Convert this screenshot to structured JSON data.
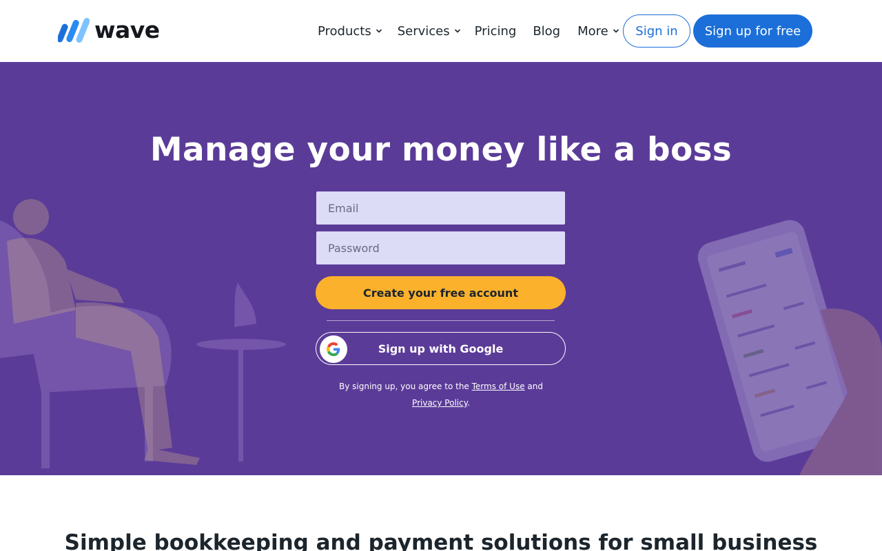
{
  "brand": {
    "name": "wave",
    "colors": {
      "primary_blue": "#1c6fd8",
      "hero_purple": "#5b3b98",
      "cta_yellow": "#fbb12c",
      "input_bg": "#dcdcf7"
    }
  },
  "header": {
    "nav": [
      {
        "label": "Products",
        "has_dropdown": true
      },
      {
        "label": "Services",
        "has_dropdown": true
      },
      {
        "label": "Pricing",
        "has_dropdown": false
      },
      {
        "label": "Blog",
        "has_dropdown": false
      },
      {
        "label": "More",
        "has_dropdown": true
      }
    ],
    "signin_label": "Sign in",
    "signup_label": "Sign up for free"
  },
  "hero": {
    "title": "Manage your money like a boss",
    "email_placeholder": "Email",
    "password_placeholder": "Password",
    "create_label": "Create your free account",
    "google_label": "Sign up with Google",
    "legal_prefix": "By signing up, you agree to the",
    "terms_label": "Terms of Use",
    "legal_and": "and",
    "privacy_label": "Privacy Policy",
    "legal_suffix": "."
  },
  "section": {
    "title": "Simple bookkeeping and payment solutions for small business"
  },
  "icons": {
    "logo": "wave-logo-icon",
    "caret": "chevron-down-icon",
    "google": "google-g-icon"
  }
}
